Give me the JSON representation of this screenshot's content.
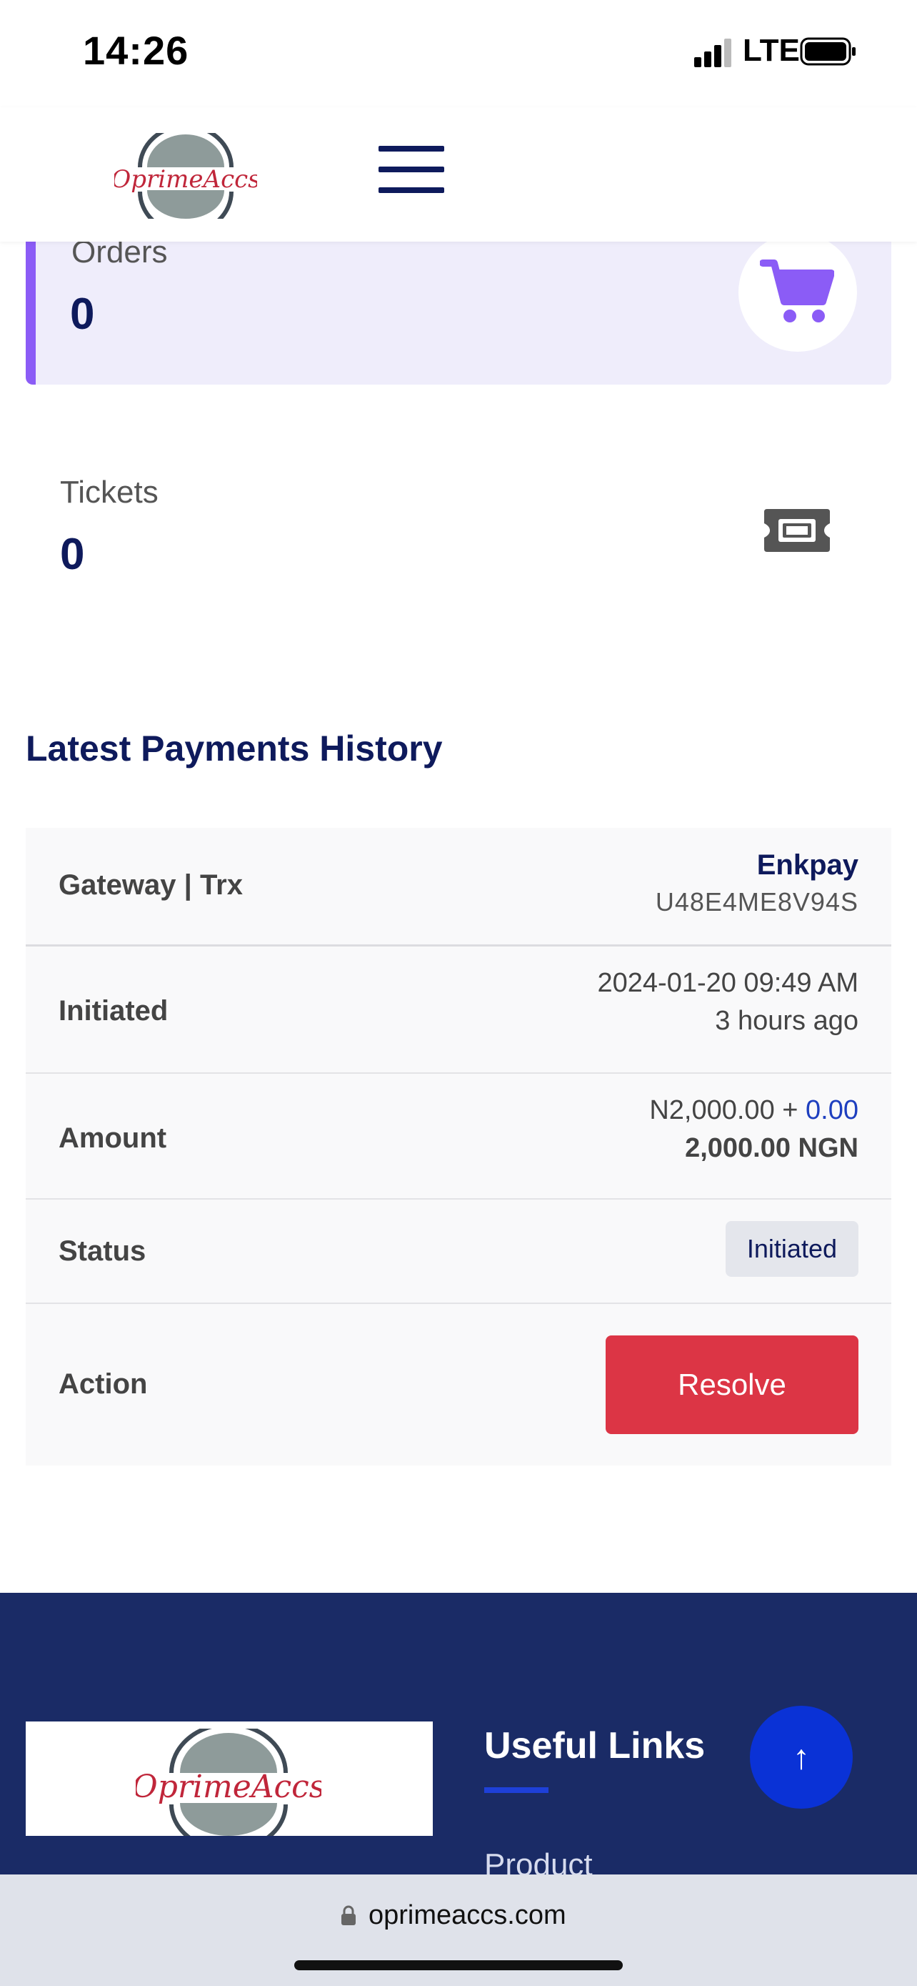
{
  "status_bar": {
    "time": "14:26",
    "network": "LTE"
  },
  "header": {
    "logo_text": "OprimeAccs",
    "menu_icon": "hamburger-menu-icon"
  },
  "stats": {
    "orders": {
      "label": "Orders",
      "value": "0",
      "icon": "shopping-cart-icon",
      "accent": "#8b5cf6"
    },
    "tickets": {
      "label": "Tickets",
      "value": "0",
      "icon": "ticket-icon"
    }
  },
  "payments": {
    "title": "Latest Payments History",
    "rows": {
      "gateway": {
        "label": "Gateway | Trx",
        "name": "Enkpay",
        "trx": "U48E4ME8V94S"
      },
      "initiated": {
        "label": "Initiated",
        "datetime": "2024-01-20 09:49 AM",
        "relative": "3 hours ago"
      },
      "amount": {
        "label": "Amount",
        "base": "N2,000.00",
        "plus": " + ",
        "charge": "0.00",
        "total": "2,000.00 NGN"
      },
      "status": {
        "label": "Status",
        "badge": "Initiated"
      },
      "action": {
        "label": "Action",
        "button": "Resolve",
        "button_color": "#dc3545"
      }
    }
  },
  "footer": {
    "logo_text": "OprimeAccs",
    "useful_links_title": "Useful Links",
    "links": [
      "Product"
    ],
    "scroll_top_symbol": "↑",
    "background": "#1a2b66"
  },
  "browser": {
    "url": "oprimeaccs.com"
  }
}
